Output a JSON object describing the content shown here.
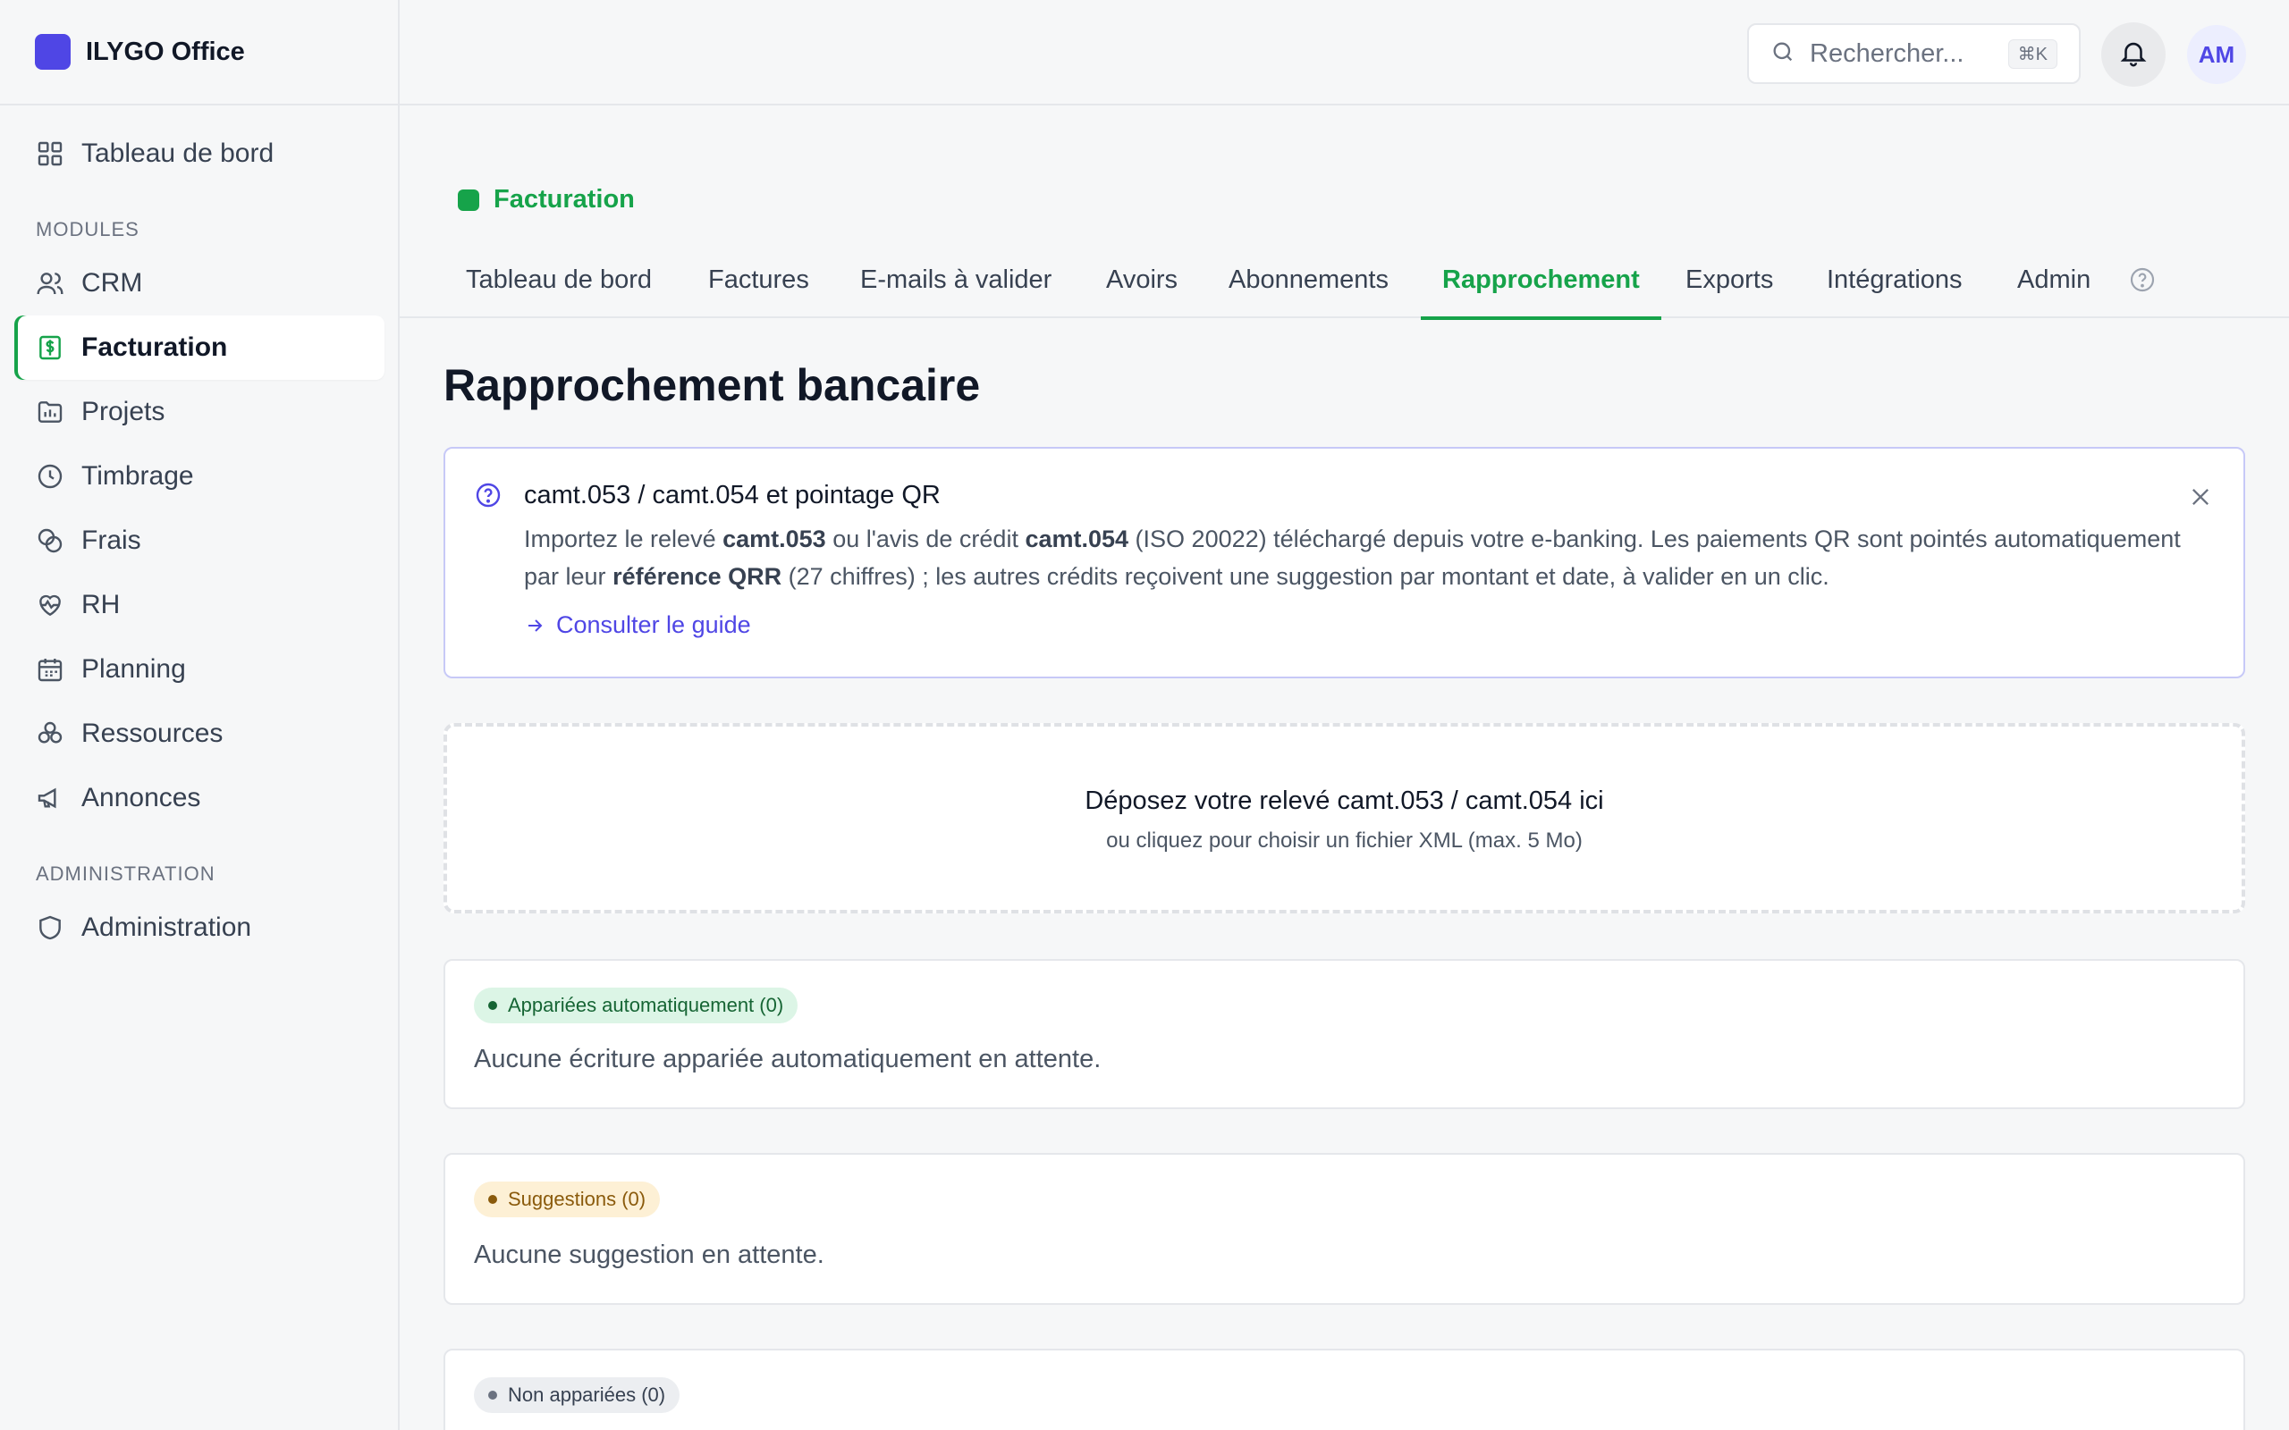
{
  "app": {
    "name": "ILYGO Office"
  },
  "sidebar": {
    "dashboard": "Tableau de bord",
    "modules_label": "MODULES",
    "admin_label": "ADMINISTRATION",
    "items": [
      {
        "label": "CRM",
        "icon": "users-icon"
      },
      {
        "label": "Facturation",
        "icon": "invoice-icon",
        "active": true
      },
      {
        "label": "Projets",
        "icon": "folder-icon"
      },
      {
        "label": "Timbrage",
        "icon": "clock-icon"
      },
      {
        "label": "Frais",
        "icon": "coins-icon"
      },
      {
        "label": "RH",
        "icon": "heart-pulse-icon"
      },
      {
        "label": "Planning",
        "icon": "calendar-icon"
      },
      {
        "label": "Ressources",
        "icon": "boxes-icon"
      },
      {
        "label": "Annonces",
        "icon": "megaphone-icon"
      }
    ],
    "administration": "Administration"
  },
  "header": {
    "search_placeholder": "Rechercher...",
    "search_shortcut": "⌘K",
    "avatar_initials": "AM"
  },
  "module": {
    "name": "Facturation",
    "tabs": [
      "Tableau de bord",
      "Factures",
      "E-mails à valider",
      "Avoirs",
      "Abonnements",
      "Rapprochement",
      "Exports",
      "Intégrations",
      "Admin"
    ],
    "active_tab": "Rapprochement"
  },
  "page": {
    "title": "Rapprochement bancaire",
    "info": {
      "title": "camt.053 / camt.054 et pointage QR",
      "body": {
        "p1": "Importez le relevé ",
        "b1": "camt.053",
        "p2": " ou l'avis de crédit ",
        "b2": "camt.054",
        "p3": " (ISO 20022) téléchargé depuis votre e-banking. Les paiements QR sont pointés automatiquement par leur ",
        "b3": "référence QRR",
        "p4": " (27 chiffres) ; les autres crédits reçoivent une suggestion par montant et date, à valider en un clic."
      },
      "link": "Consulter le guide"
    },
    "dropzone": {
      "title": "Déposez votre relevé camt.053 / camt.054 ici",
      "subtitle": "ou cliquez pour choisir un fichier XML (max. 5 Mo)"
    },
    "sections": [
      {
        "badge": "Appariées automatiquement (0)",
        "message": "Aucune écriture appariée automatiquement en attente.",
        "tone": "green"
      },
      {
        "badge": "Suggestions (0)",
        "message": "Aucune suggestion en attente.",
        "tone": "amber"
      },
      {
        "badge": "Non appariées (0)",
        "message": "",
        "tone": "gray"
      }
    ]
  },
  "colors": {
    "accent": "#16a34a",
    "brand": "#4f46e5",
    "background": "#f6f7f8"
  }
}
